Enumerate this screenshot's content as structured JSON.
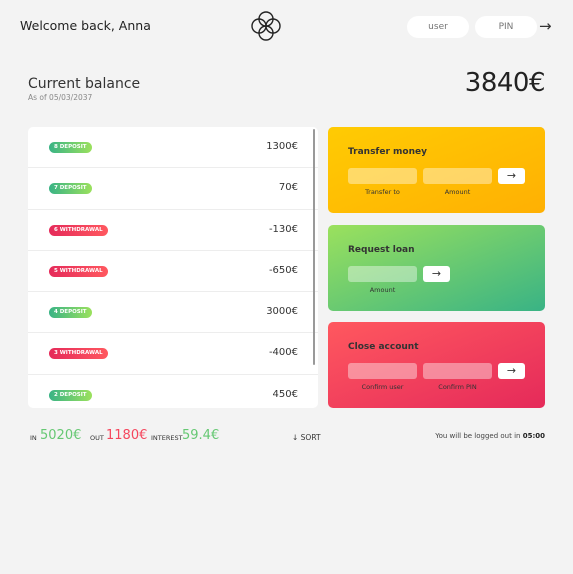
{
  "nav": {
    "welcome": "Welcome back, Anna",
    "logo": "flower-logo-icon",
    "user_placeholder": "user",
    "pin_placeholder": "PIN",
    "login_arrow": "→"
  },
  "balance": {
    "label": "Current balance",
    "date_prefix": "As of",
    "date": "05/03/2037",
    "value": "3840€"
  },
  "movements": [
    {
      "type_label": "8 DEPOSIT",
      "kind": "deposit",
      "value": "1300€"
    },
    {
      "type_label": "7 DEPOSIT",
      "kind": "deposit",
      "value": "70€"
    },
    {
      "type_label": "6 WITHDRAWAL",
      "kind": "withdrawal",
      "value": "-130€"
    },
    {
      "type_label": "5 WITHDRAWAL",
      "kind": "withdrawal",
      "value": "-650€"
    },
    {
      "type_label": "4 DEPOSIT",
      "kind": "deposit",
      "value": "3000€"
    },
    {
      "type_label": "3 WITHDRAWAL",
      "kind": "withdrawal",
      "value": "-400€"
    },
    {
      "type_label": "2 DEPOSIT",
      "kind": "deposit",
      "value": "450€"
    }
  ],
  "operations": {
    "transfer": {
      "title": "Transfer money",
      "label_to": "Transfer to",
      "label_amount": "Amount",
      "button": "→"
    },
    "loan": {
      "title": "Request loan",
      "label_amount": "Amount",
      "button": "→"
    },
    "close": {
      "title": "Close account",
      "label_user": "Confirm user",
      "label_pin": "Confirm PIN",
      "button": "→"
    }
  },
  "summary": {
    "in_label": "In",
    "in_value": "5020€",
    "out_label": "Out",
    "out_value": "1180€",
    "interest_label": "Interest",
    "interest_value": "59.4€",
    "sort_label": "↓ SORT"
  },
  "logout": {
    "text": "You will be logged out in",
    "time": "05:00"
  },
  "colors": {
    "deposit": "#39b385",
    "withdrawal": "#e52a5a",
    "transfer": "#ffb003",
    "loan": "#39b385",
    "close": "#e52a5a"
  }
}
